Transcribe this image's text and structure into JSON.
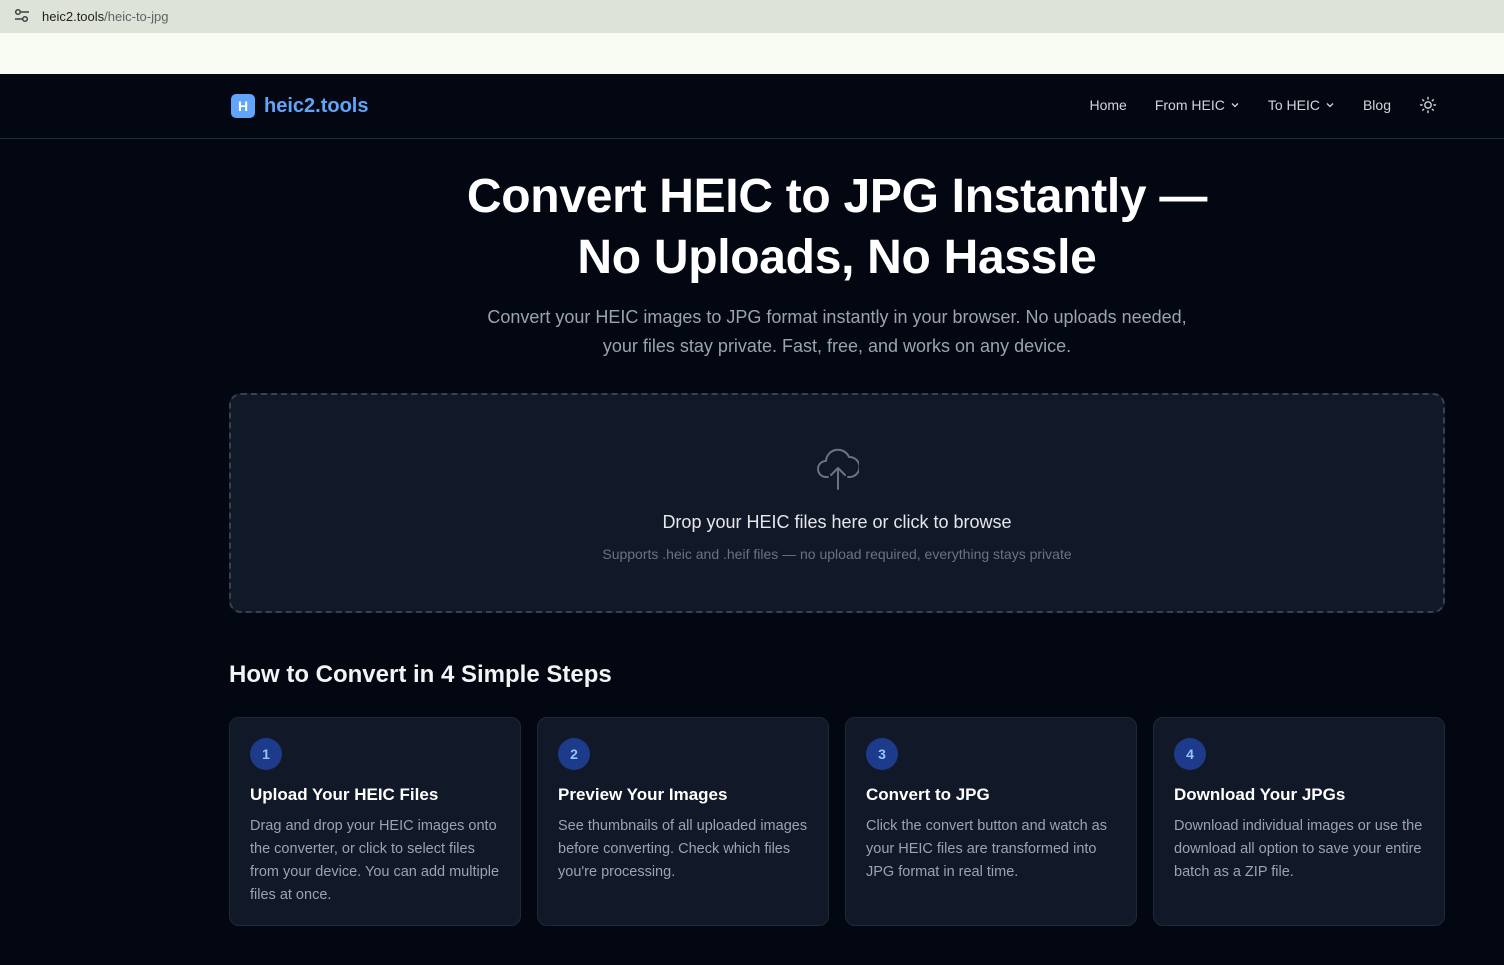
{
  "browser": {
    "url_host": "heic2.tools",
    "url_path": "/heic-to-jpg"
  },
  "header": {
    "logo_letter": "H",
    "logo_text": "heic2.tools",
    "nav": {
      "home": "Home",
      "from_heic": "From HEIC",
      "to_heic": "To HEIC",
      "blog": "Blog"
    },
    "theme_icon": "sun-icon"
  },
  "hero": {
    "title_line1": "Convert HEIC to JPG Instantly —",
    "title_line2": "No Uploads, No Hassle",
    "subtitle_line1": "Convert your HEIC images to JPG format instantly in your browser. No uploads needed,",
    "subtitle_line2": "your files stay private. Fast, free, and works on any device."
  },
  "dropzone": {
    "icon": "cloud-upload-icon",
    "title": "Drop your HEIC files here or click to browse",
    "subtitle": "Supports .heic and .heif files — no upload required, everything stays private"
  },
  "steps": {
    "heading": "How to Convert in 4 Simple Steps",
    "items": [
      {
        "num": "1",
        "title": "Upload Your HEIC Files",
        "desc": "Drag and drop your HEIC images onto the converter, or click to select files from your device. You can add multiple files at once."
      },
      {
        "num": "2",
        "title": "Preview Your Images",
        "desc": "See thumbnails of all uploaded images before converting. Check which files you're processing."
      },
      {
        "num": "3",
        "title": "Convert to JPG",
        "desc": "Click the convert button and watch as your HEIC files are transformed into JPG format in real time."
      },
      {
        "num": "4",
        "title": "Download Your JPGs",
        "desc": "Download individual images or use the download all option to save your entire batch as a ZIP file."
      }
    ]
  },
  "colors": {
    "background": "#030712",
    "accent": "#60a5fa",
    "card": "#111827"
  }
}
